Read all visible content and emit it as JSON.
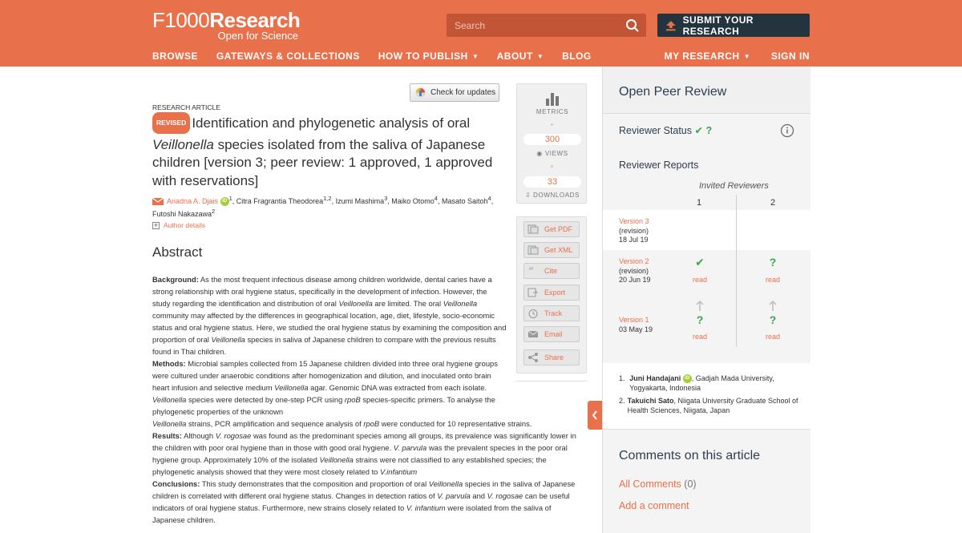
{
  "header": {
    "logo_main_f": "F1000",
    "logo_main_research": "Research",
    "logo_sub": "Open for Science",
    "search_placeholder": "Search",
    "submit_label": "SUBMIT YOUR RESEARCH",
    "nav_left": [
      "BROWSE",
      "GATEWAYS & COLLECTIONS",
      "HOW TO PUBLISH",
      "ABOUT",
      "BLOG"
    ],
    "nav_right": [
      "MY RESEARCH",
      "SIGN IN"
    ],
    "accent_color": "#e8704a",
    "dark_color": "#23343f"
  },
  "article": {
    "check_updates": "Check for updates",
    "type": "RESEARCH ARTICLE",
    "revised_badge": "REVISED",
    "title_part1": "Identification and phylogenetic analysis of oral ",
    "title_italic": "Veillonella",
    "title_part2": " species isolated from the saliva of Japanese children [version 3; peer review: 1 approved, 1 approved with reservations]",
    "first_author": "Ariadna A. Djais",
    "orcid": "iD",
    "first_author_sup": "1",
    "other_authors": ", Citra Fragrantia Theodorea",
    "sup_12": "1,2",
    "izumi": ", Izumi Mashima",
    "sup_3": "3",
    "maiko": ", Maiko Otomo",
    "sup_4a": "4",
    "masato": ", Masato Saitoh",
    "sup_4b": "4",
    "futoshi": ", Futoshi Nakazawa",
    "sup_2": "2",
    "author_details": "Author details",
    "abstract_heading": "Abstract",
    "bg_label": "Background:",
    "bg_1": " As the most frequent infectious disease among children worldwide, dental caries have a strong relationship with oral hygiene status, specifically in the development of infection. However, the study regarding the identification and distribution of oral ",
    "bg_i1": "Veillonella",
    "bg_2": " are limited. The oral ",
    "bg_i2": "Veillonella",
    "bg_3": " community may affected by the differences in geographical location, age, diet, lifestyle, socio-economic status and oral hygiene status. Here, we studied the oral hygiene status by examining the composition and proportion of oral ",
    "bg_i3": "Veillonella",
    "bg_4": " species in saliva of Japanese children to compare with the previous results found in Thai children.",
    "me_label": "Methods:",
    "me_1": " Microbial samples collected from 15 Japanese children divided into three oral hygiene groups were cultured under anaerobic conditions after homogenization and dilution, and inoculated onto brain heart infusion and selective medium ",
    "me_i1": "Veillonella",
    "me_2": " agar. Genomic DNA was extracted from each isolate. ",
    "me_i2": "Veillonella",
    "me_3": " species were detected by one-step PCR using ",
    "me_i3": "rpoB",
    "me_4": " species-specific primers. To analyse the phylogenetic properties of the unknown ",
    "me_i4": "Veillonella",
    "me_5": " strains, PCR amplification and sequence analysis of ",
    "me_i5": "rpoB",
    "me_6": " were conducted for 10 representative strains.",
    "re_label": "Results:",
    "re_1": " Although ",
    "re_i1": "V. rogosae",
    "re_2": " was found as the predominant species among all groups, its prevalence was significantly lower in the children with poor oral hygiene than in those with good oral hygiene. ",
    "re_i2": "V. parvula",
    "re_3": " was the prevalent species in the poor oral hygiene group. Approximately 10% of the isolated ",
    "re_i3": "Veillonella",
    "re_4": " strains were not classified to any established species; the phylogenetic analysis showed that they were most closely related to ",
    "re_i4": "V.infantium",
    "co_label": "Conclusions:",
    "co_1": " This study demonstrates that the composition and proportion of oral ",
    "co_i1": "Veillonella",
    "co_2": " species in the saliva of Japanese children is correlated with different oral hygiene status. Changes in detection ratios of ",
    "co_i2": "V. parvula",
    "co_3": " and ",
    "co_i3": "V. rogosae",
    "co_4": " can be useful indicators of oral hygiene status. Furthermore, new strains closely related to ",
    "co_i4": "V. infantium",
    "co_5": " were isolated from the saliva of Japanese children."
  },
  "metrics": {
    "label": "METRICS",
    "views_count": "300",
    "views_label": "VIEWS",
    "downloads_count": "33",
    "downloads_label": "DOWNLOADS"
  },
  "actions": [
    "Get PDF",
    "Get XML",
    "Cite",
    "Export",
    "Track",
    "Email",
    "Share"
  ],
  "review": {
    "title": "Open Peer Review",
    "status_label": "Reviewer Status",
    "status_check": "✔",
    "status_q": "?",
    "reports_title": "Reviewer Reports",
    "invited": "Invited Reviewers",
    "col1": "1",
    "col2": "2",
    "v3_link": "Version 3",
    "v3_type": "(revision)",
    "v3_date": "18 Jul 19",
    "v2_link": "Version 2",
    "v2_type": "(revision)",
    "v2_date": "20 Jun 19",
    "v1_link": "Version 1",
    "v1_date": "03 May 19",
    "check": "✔",
    "question": "?",
    "read": "read",
    "reviewers": [
      {
        "num": "1.",
        "name": "Juni Handajani",
        "orcid": "iD",
        "affil": ", Gadjah Mada University, Yogyakarta, Indonesia"
      },
      {
        "num": "2.",
        "name": "Takuichi Sato",
        "affil": ", Niigata University Graduate School of Health Sciences, Niigata, Japan"
      }
    ]
  },
  "comments": {
    "title": "Comments on this article",
    "all_label": "All Comments",
    "all_count": "(0)",
    "add_label": "Add a comment"
  }
}
